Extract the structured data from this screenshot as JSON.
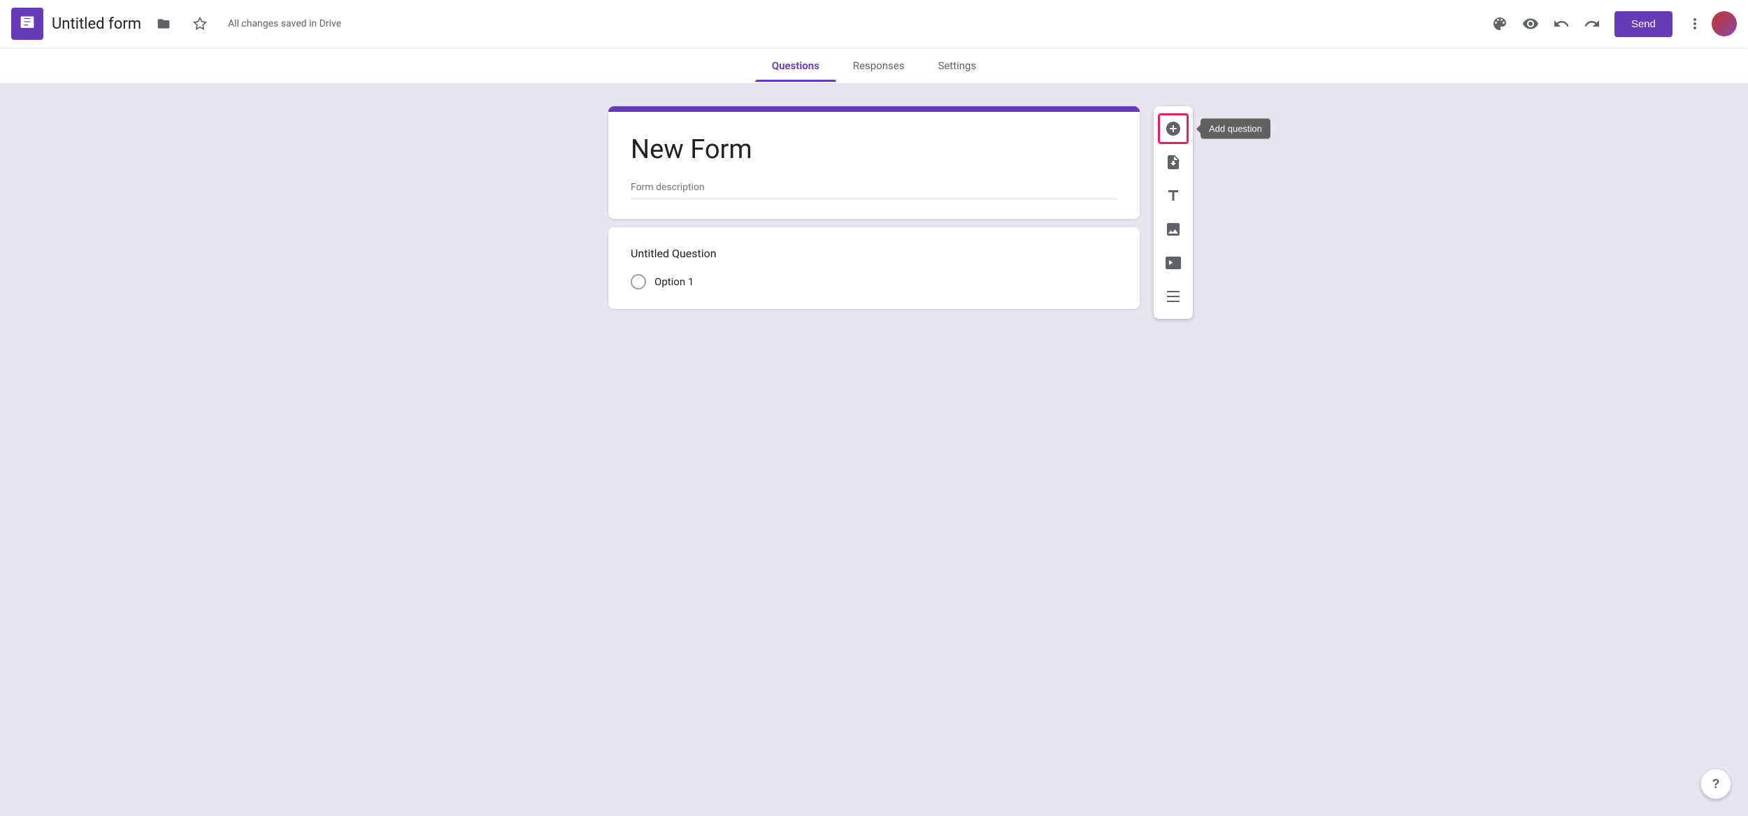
{
  "header": {
    "app_icon_label": "Google Forms",
    "form_title": "Untitled form",
    "save_status": "All changes saved in Drive",
    "send_button_label": "Send",
    "more_options_label": "More options"
  },
  "tabs": [
    {
      "id": "questions",
      "label": "Questions",
      "active": true
    },
    {
      "id": "responses",
      "label": "Responses",
      "active": false
    },
    {
      "id": "settings",
      "label": "Settings",
      "active": false
    }
  ],
  "form": {
    "title": "New Form",
    "description_placeholder": "Form description"
  },
  "question": {
    "title": "Untitled Question",
    "options": [
      {
        "label": "Option 1"
      }
    ]
  },
  "toolbar": {
    "add_question_label": "Add question",
    "add_title_label": "Add title and description",
    "add_image_label": "Add image",
    "add_video_label": "Add video",
    "add_section_label": "Add section"
  },
  "help": {
    "label": "?"
  }
}
